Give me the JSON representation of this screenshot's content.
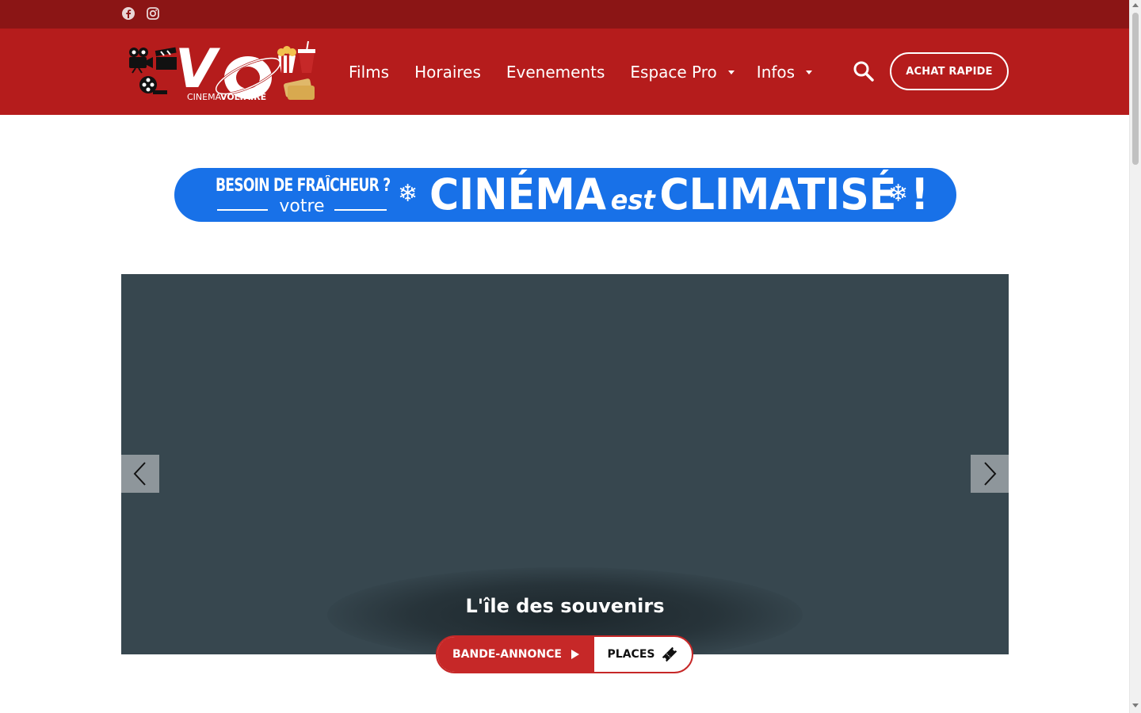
{
  "topbar": {
    "social": [
      {
        "icon": "facebook-icon"
      },
      {
        "icon": "instagram-icon"
      }
    ]
  },
  "header": {
    "logo": {
      "mark": "VO",
      "name_part1": "CINEMA",
      "name_part2": "VOLTAIRE"
    },
    "nav": [
      {
        "label": "Films"
      },
      {
        "label": "Horaires"
      },
      {
        "label": "Evenements"
      },
      {
        "label": "Espace Pro"
      },
      {
        "label": "Infos"
      }
    ],
    "search_icon": "search-icon",
    "quick_buy_label": "ACHAT RAPIDE"
  },
  "banner": {
    "line1": "BESOIN DE FRAÎCHEUR ?",
    "line2": "votre",
    "big_part1": "CINÉMA",
    "big_est": "est",
    "big_part2": "CLIMATISÉ !",
    "flake": "❄"
  },
  "carousel": {
    "movie_title": "L'île des souvenirs",
    "prev_icon": "chevron-left-icon",
    "next_icon": "chevron-right-icon"
  },
  "actions": {
    "trailer_label": "BANDE-ANNONCE",
    "places_label": "PLACES"
  },
  "colors": {
    "topbar": "#8b1515",
    "header": "#b51c1c",
    "banner": "#1871e8",
    "carousel": "#37474f",
    "accent": "#c62828"
  }
}
